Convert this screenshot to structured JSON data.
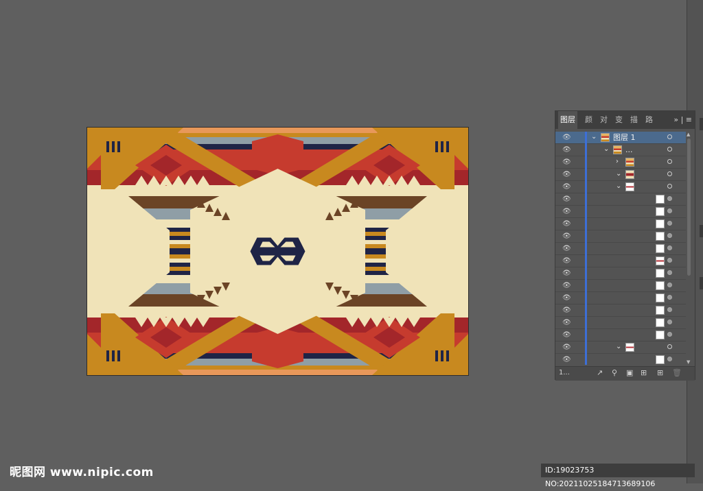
{
  "panel": {
    "tabs": [
      "图层",
      "颜色",
      "对齐",
      "变换",
      "描边",
      "路径"
    ],
    "menu_icon": "panel-menu-icon",
    "layer_count": "1...",
    "rows": [
      {
        "label": "图层 1",
        "depth": 0,
        "expanded": true,
        "thumb": "art",
        "selected": true
      },
      {
        "label": "...",
        "depth": 1,
        "expanded": true,
        "thumb": "art"
      },
      {
        "label": "",
        "depth": 2,
        "expanded": false,
        "thumb": "art"
      },
      {
        "label": "",
        "depth": 2,
        "expanded": true,
        "thumb": "red"
      },
      {
        "label": "",
        "depth": 3,
        "expanded": true,
        "thumb": "whitered"
      },
      {
        "label": "",
        "depth": 4,
        "thumb": "white"
      },
      {
        "label": "",
        "depth": 4,
        "thumb": "white"
      },
      {
        "label": "",
        "depth": 4,
        "thumb": "white"
      },
      {
        "label": "",
        "depth": 4,
        "thumb": "white"
      },
      {
        "label": "",
        "depth": 4,
        "thumb": "white"
      },
      {
        "label": "",
        "depth": 4,
        "thumb": "whitered"
      },
      {
        "label": "",
        "depth": 4,
        "thumb": "white"
      },
      {
        "label": "",
        "depth": 4,
        "thumb": "white"
      },
      {
        "label": "",
        "depth": 4,
        "thumb": "white"
      },
      {
        "label": "",
        "depth": 4,
        "thumb": "white"
      },
      {
        "label": "",
        "depth": 4,
        "thumb": "white"
      },
      {
        "label": "",
        "depth": 4,
        "thumb": "white"
      },
      {
        "label": "",
        "depth": 3,
        "expanded": true,
        "thumb": "whitered"
      },
      {
        "label": "",
        "depth": 4,
        "thumb": "white"
      }
    ],
    "footer_icons": [
      "export-icon",
      "search-icon",
      "clip-mask-icon",
      "new-sublayer-icon",
      "new-layer-icon",
      "trash-icon"
    ]
  },
  "watermark": {
    "logo": "昵图网 www.nipic.com",
    "id_text": "ID:19023753 NO:20211025184713689106"
  },
  "colors": {
    "gold": "#c8891f",
    "red": "#c63b2e",
    "dark_red": "#a3262a",
    "cream": "#f0e3b8",
    "navy": "#1f2446",
    "slate": "#8f9ea6",
    "brown": "#6b4426",
    "orange": "#e8985a"
  }
}
